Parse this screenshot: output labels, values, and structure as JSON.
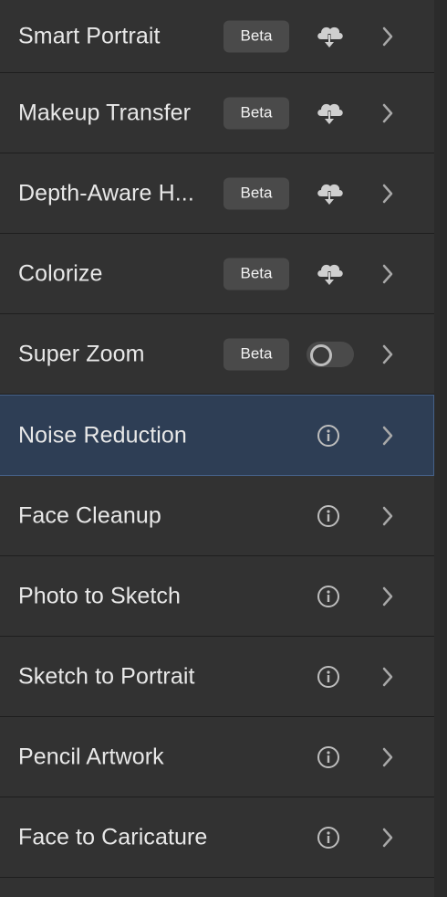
{
  "features": [
    {
      "label": "Smart Portrait",
      "badge": "Beta",
      "control": "cloud-download"
    },
    {
      "label": "Makeup Transfer",
      "badge": "Beta",
      "control": "cloud-download"
    },
    {
      "label": "Depth-Aware H...",
      "badge": "Beta",
      "control": "cloud-download"
    },
    {
      "label": "Colorize",
      "badge": "Beta",
      "control": "cloud-download"
    },
    {
      "label": "Super Zoom",
      "badge": "Beta",
      "control": "toggle"
    },
    {
      "label": "Noise Reduction",
      "badge": "",
      "control": "info",
      "selected": true
    },
    {
      "label": "Face Cleanup",
      "badge": "",
      "control": "info"
    },
    {
      "label": "Photo to Sketch",
      "badge": "",
      "control": "info"
    },
    {
      "label": "Sketch to Portrait",
      "badge": "",
      "control": "info"
    },
    {
      "label": "Pencil Artwork",
      "badge": "",
      "control": "info"
    },
    {
      "label": "Face to Caricature",
      "badge": "",
      "control": "info"
    }
  ],
  "super_zoom_toggle_on": false,
  "colors": {
    "panel_bg": "#323232",
    "selected_bg": "#2e3e55",
    "badge_bg": "#4a4a4a",
    "divider": "#1e1e1e"
  }
}
